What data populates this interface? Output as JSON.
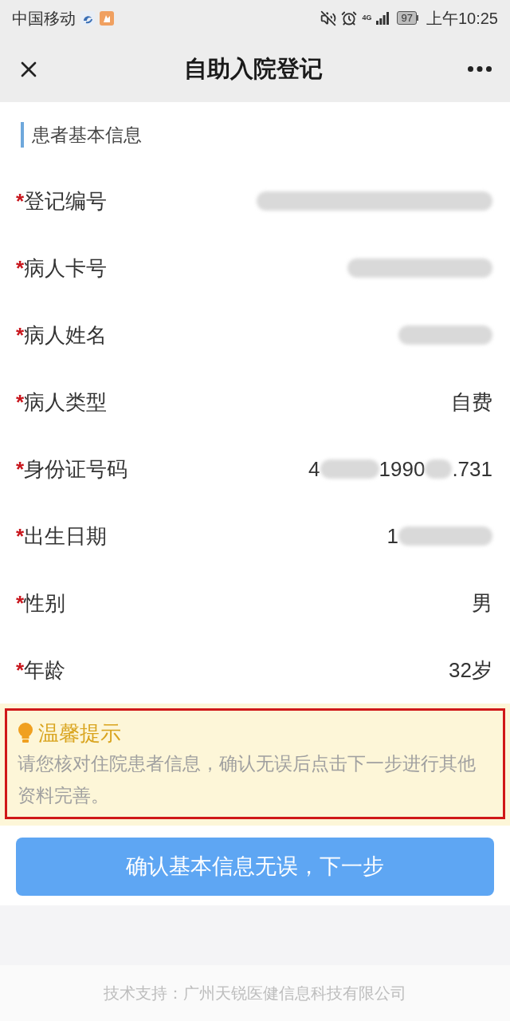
{
  "status_bar": {
    "carrier": "中国移动",
    "network": "4G",
    "battery": "97",
    "time": "上午10:25"
  },
  "nav_bar": {
    "title": "自助入院登记"
  },
  "section": {
    "title": "患者基本信息"
  },
  "fields": [
    {
      "required_mark": "*",
      "label": "登记编号",
      "value": [
        {
          "kind": "redacted"
        }
      ]
    },
    {
      "required_mark": "*",
      "label": "病人卡号",
      "value": [
        {
          "kind": "redacted"
        }
      ]
    },
    {
      "required_mark": "*",
      "label": "病人姓名",
      "value": [
        {
          "kind": "redacted"
        }
      ]
    },
    {
      "required_mark": "*",
      "label": "病人类型",
      "value": [
        {
          "kind": "text",
          "text": "自费"
        }
      ]
    },
    {
      "required_mark": "*",
      "label": "身份证号码",
      "value": [
        {
          "kind": "text",
          "text": "4"
        },
        {
          "kind": "redacted"
        },
        {
          "kind": "text",
          "text": "1990"
        },
        {
          "kind": "redacted"
        },
        {
          "kind": "text",
          "text": ".731"
        }
      ]
    },
    {
      "required_mark": "*",
      "label": "出生日期",
      "value": [
        {
          "kind": "text",
          "text": "1"
        },
        {
          "kind": "redacted"
        }
      ]
    },
    {
      "required_mark": "*",
      "label": "性别",
      "value": [
        {
          "kind": "text",
          "text": "男"
        }
      ]
    },
    {
      "required_mark": "*",
      "label": "年龄",
      "value": [
        {
          "kind": "text",
          "text": "32岁"
        }
      ]
    }
  ],
  "tip": {
    "title": "温馨提示",
    "text": "请您核对住院患者信息，确认无误后点击下一步进行其他资料完善。",
    "highlighted": true
  },
  "primary_button": {
    "label": "确认基本信息无误，下一步"
  },
  "footer": {
    "text": "技术支持：广州天锐医健信息科技有限公司"
  }
}
